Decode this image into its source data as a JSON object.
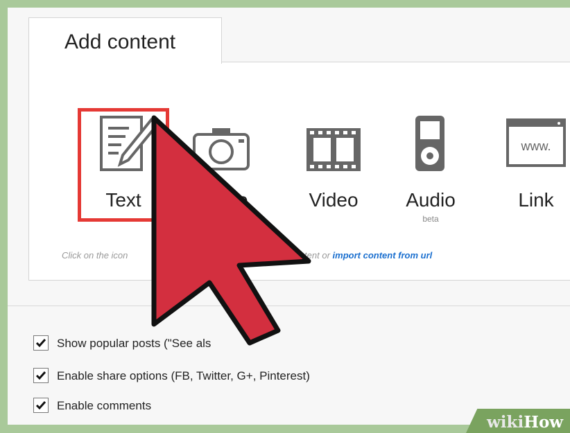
{
  "tab": {
    "title": "Add content"
  },
  "content_types": [
    {
      "label": "Text",
      "icon": "text-document-icon",
      "selected": true
    },
    {
      "label": "Photo",
      "icon": "camera-icon"
    },
    {
      "label": "Video",
      "icon": "film-icon"
    },
    {
      "label": "Audio",
      "sub": "beta",
      "icon": "audio-player-icon"
    },
    {
      "label": "Link",
      "icon": "web-page-icon",
      "icon_text": "www."
    }
  ],
  "hint": {
    "prefix": "Click on the icon",
    "middle": "of content or",
    "link": "import content from url"
  },
  "options": [
    {
      "label": "Show popular posts (\"See als",
      "checked": true
    },
    {
      "label": "Enable share options (FB, Twitter, G+, Pinterest)",
      "checked": true
    },
    {
      "label": "Enable comments",
      "checked": true
    }
  ],
  "watermark": {
    "wiki": "wiki",
    "how": "How"
  },
  "colors": {
    "accent_red": "#e53935",
    "cursor_red": "#d32f3f",
    "link_blue": "#1a6fcf",
    "frame_green": "#a9c99a"
  }
}
